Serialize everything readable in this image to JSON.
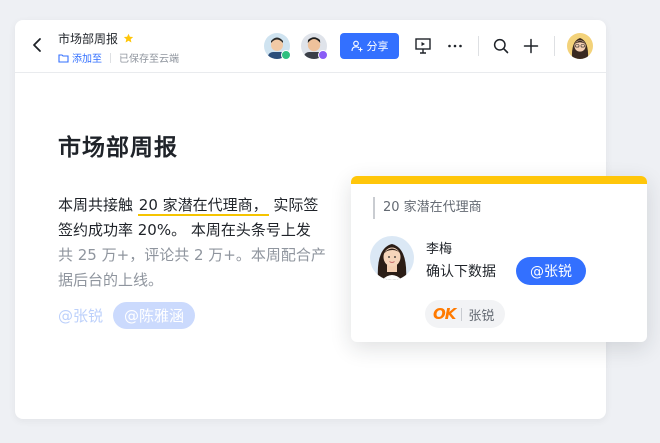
{
  "header": {
    "title": "市场部周报",
    "add_to": "添加至",
    "save_status": "已保存至云端",
    "share_label": "分享"
  },
  "icons": {
    "back": "chevron-left-icon",
    "star": "star-icon",
    "folder": "folder-icon",
    "share": "add-user-icon",
    "present": "presentation-icon",
    "more": "more-icon",
    "search": "search-icon",
    "add": "plus-icon"
  },
  "colors": {
    "accent": "#3370ff",
    "star": "#ffc60a",
    "highlight": "#f5c400",
    "online_green": "#2ec080",
    "online_purple": "#8a5cf6"
  },
  "document": {
    "heading": "市场部周报",
    "lines": [
      {
        "before": "本周共接触 ",
        "highlight": "20 家潜在代理商，",
        "after": " 实际签"
      },
      {
        "text": "签约成功率 20%。 本周在头条号上发"
      },
      {
        "text": "共 25 万+，评论共 2 万+。本周配合产"
      },
      {
        "text": "据后台的上线。"
      }
    ],
    "mentions": [
      "@张锐",
      "@陈雅涵"
    ]
  },
  "comment": {
    "quote": "20 家潜在代理商",
    "author": "李梅",
    "text": "确认下数据",
    "mention": "@张锐",
    "reaction": {
      "emoji": "OK",
      "user": "张锐"
    }
  }
}
